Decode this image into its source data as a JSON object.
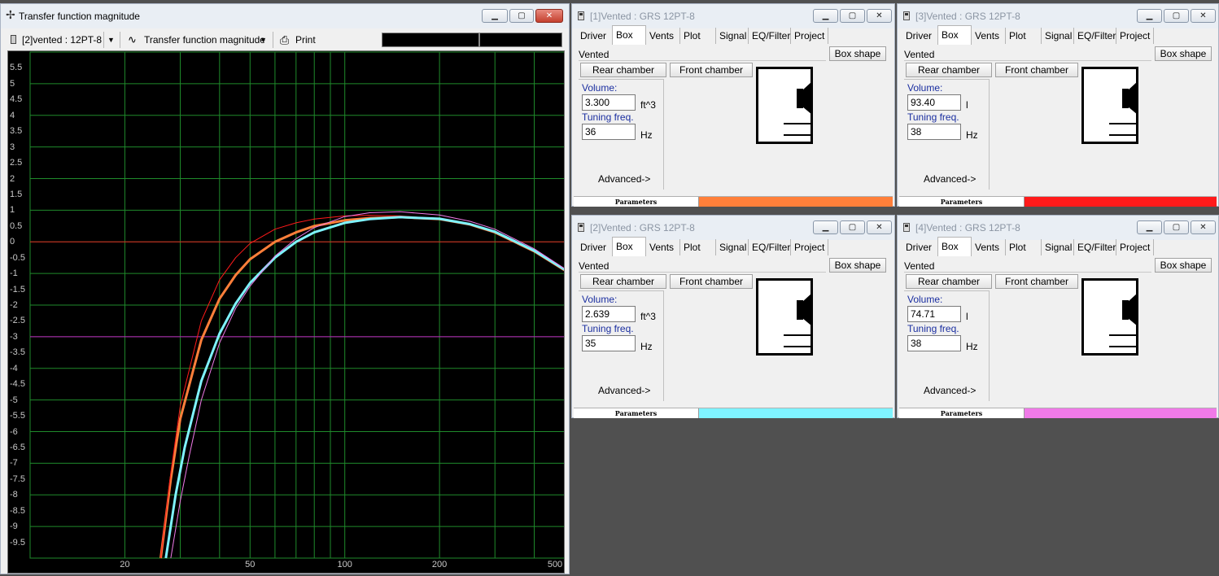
{
  "graph_window": {
    "title": "Transfer function magnitude",
    "toolbar": {
      "selector_label": "[2]vented : 12PT-8",
      "plot_type_label": "Transfer function magnitude",
      "print_label": "Print"
    },
    "chart_data": {
      "type": "line",
      "title": "",
      "xlabel": "",
      "ylabel": "",
      "x_scale": "log",
      "xlim": [
        10,
        500
      ],
      "ylim": [
        -10,
        6
      ],
      "grid": true,
      "background": "#000000",
      "grid_color": "#1f8a2b",
      "y_ticks": [
        "5.5",
        "5",
        "4.5",
        "4",
        "3.5",
        "3",
        "2.5",
        "2",
        "1.5",
        "1",
        "0.5",
        "0",
        "-0.5",
        "-1",
        "-1.5",
        "-2",
        "-2.5",
        "-3",
        "-3.5",
        "-4",
        "-4.5",
        "-5",
        "-5.5",
        "-6",
        "-6.5",
        "-7",
        "-7.5",
        "-8",
        "-8.5",
        "-9",
        "-9.5"
      ],
      "x_ticks": [
        "20",
        "50",
        "100",
        "200",
        "500"
      ],
      "reference_lines": [
        {
          "y": 0,
          "color": "#e02020"
        },
        {
          "y": -3,
          "color": "#c020c0"
        }
      ],
      "series": [
        {
          "color": "#ff7f3a",
          "width": 3,
          "x": [
            26,
            28,
            30,
            35,
            40,
            45,
            50,
            60,
            70,
            80,
            100,
            120,
            150,
            200,
            250,
            300,
            400,
            500
          ],
          "y": [
            -10,
            -7.5,
            -5.6,
            -3.1,
            -1.8,
            -1.05,
            -0.55,
            0,
            0.3,
            0.5,
            0.68,
            0.75,
            0.78,
            0.72,
            0.55,
            0.3,
            -0.3,
            -0.9
          ]
        },
        {
          "color": "#ff1a1a",
          "width": 1,
          "x": [
            26,
            28,
            30,
            35,
            40,
            45,
            50,
            60,
            70,
            80,
            100,
            120,
            150,
            200,
            250,
            300,
            400,
            500
          ],
          "y": [
            -10,
            -7.3,
            -5.2,
            -2.5,
            -1.2,
            -0.5,
            -0.05,
            0.4,
            0.6,
            0.72,
            0.82,
            0.84,
            0.82,
            0.73,
            0.55,
            0.3,
            -0.3,
            -0.9
          ]
        },
        {
          "color": "#7ff3ff",
          "width": 3,
          "x": [
            27,
            29,
            31,
            35,
            40,
            45,
            50,
            60,
            70,
            80,
            100,
            120,
            150,
            200,
            250,
            300,
            400,
            500
          ],
          "y": [
            -10,
            -8,
            -6.5,
            -4.4,
            -2.9,
            -1.95,
            -1.3,
            -0.5,
            0,
            0.3,
            0.6,
            0.72,
            0.78,
            0.73,
            0.56,
            0.32,
            -0.28,
            -0.88
          ]
        },
        {
          "color": "#f07ae8",
          "width": 1,
          "x": [
            28,
            30,
            32,
            35,
            40,
            45,
            50,
            60,
            70,
            80,
            100,
            120,
            150,
            200,
            250,
            300,
            400,
            500
          ],
          "y": [
            -10,
            -8.2,
            -6.8,
            -5.0,
            -3.2,
            -2.1,
            -1.4,
            -0.45,
            0.1,
            0.45,
            0.8,
            0.92,
            0.95,
            0.85,
            0.65,
            0.4,
            -0.22,
            -0.85
          ]
        }
      ]
    }
  },
  "box_windows": [
    {
      "title": "[1]Vented : GRS 12PT-8",
      "tabs": [
        "Driver",
        "Box",
        "Vents",
        "Plot",
        "Signal",
        "EQ/Filter",
        "Project"
      ],
      "box_type": "Vented",
      "box_shape_label": "Box shape",
      "rear_chamber_label": "Rear chamber",
      "front_chamber_label": "Front chamber",
      "volume_label": "Volume:",
      "volume_value": "3.300",
      "volume_unit": "ft^3",
      "tuning_label": "Tuning freq.",
      "tuning_value": "36",
      "tuning_unit": "Hz",
      "advanced_label": "Advanced->",
      "status_label": "Parameters",
      "color": "#ff7f3a"
    },
    {
      "title": "[3]Vented : GRS 12PT-8",
      "tabs": [
        "Driver",
        "Box",
        "Vents",
        "Plot",
        "Signal",
        "EQ/Filter",
        "Project"
      ],
      "box_type": "Vented",
      "box_shape_label": "Box shape",
      "rear_chamber_label": "Rear chamber",
      "front_chamber_label": "Front chamber",
      "volume_label": "Volume:",
      "volume_value": "93.40",
      "volume_unit": "l",
      "tuning_label": "Tuning freq.",
      "tuning_value": "38",
      "tuning_unit": "Hz",
      "advanced_label": "Advanced->",
      "status_label": "Parameters",
      "color": "#ff1a1a"
    },
    {
      "title": "[2]Vented : GRS 12PT-8",
      "tabs": [
        "Driver",
        "Box",
        "Vents",
        "Plot",
        "Signal",
        "EQ/Filter",
        "Project"
      ],
      "box_type": "Vented",
      "box_shape_label": "Box shape",
      "rear_chamber_label": "Rear chamber",
      "front_chamber_label": "Front chamber",
      "volume_label": "Volume:",
      "volume_value": "2.639",
      "volume_unit": "ft^3",
      "tuning_label": "Tuning freq.",
      "tuning_value": "35",
      "tuning_unit": "Hz",
      "advanced_label": "Advanced->",
      "status_label": "Parameters",
      "color": "#7ff3ff"
    },
    {
      "title": "[4]Vented : GRS 12PT-8",
      "tabs": [
        "Driver",
        "Box",
        "Vents",
        "Plot",
        "Signal",
        "EQ/Filter",
        "Project"
      ],
      "box_type": "Vented",
      "box_shape_label": "Box shape",
      "rear_chamber_label": "Rear chamber",
      "front_chamber_label": "Front chamber",
      "volume_label": "Volume:",
      "volume_value": "74.71",
      "volume_unit": "l",
      "tuning_label": "Tuning freq.",
      "tuning_value": "38",
      "tuning_unit": "Hz",
      "advanced_label": "Advanced->",
      "status_label": "Parameters",
      "color": "#f07ae8"
    }
  ]
}
